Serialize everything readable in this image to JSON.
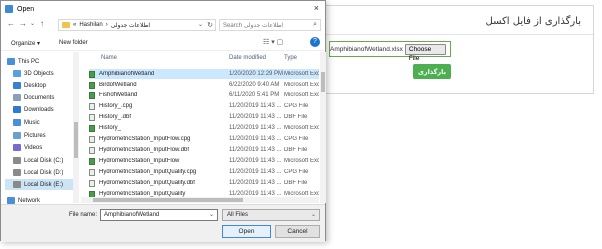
{
  "web": {
    "title": "بارگذاری از فایل اکسل",
    "file_name": "AmphibianofWetland.xlsx",
    "choose_label": "Choose File",
    "upload_label": "بارگذاری",
    "colors": {
      "upload": "#4cb050",
      "border": "#6aa84f"
    }
  },
  "dialog": {
    "title": "Open",
    "close_glyph": "×",
    "nav": {
      "back": "←",
      "forward": "→",
      "up": "↑",
      "recent": "⌄"
    },
    "address": {
      "prefix": "«",
      "part1": "Hashilan",
      "sep": "›",
      "part2": "اطلاعات جدولی",
      "dropdown": "⌄",
      "refresh": "↻"
    },
    "search": {
      "placeholder": "Search اطلاعات جدولی",
      "icon": "⌕"
    },
    "toolbar": {
      "organize": "Organize ▾",
      "new_folder": "New folder",
      "view": "☷ ▾ ▢",
      "help": "?"
    },
    "sidebar": [
      {
        "label": "This PC",
        "icon": "computer-icon",
        "color": "#4a90d9"
      },
      {
        "label": "3D Objects",
        "icon": "cube-icon",
        "color": "#5aa0e0"
      },
      {
        "label": "Desktop",
        "icon": "desktop-icon",
        "color": "#3b7fd0"
      },
      {
        "label": "Documents",
        "icon": "documents-icon",
        "color": "#8aa0b8"
      },
      {
        "label": "Downloads",
        "icon": "download-icon",
        "color": "#2f7ad0"
      },
      {
        "label": "Music",
        "icon": "music-icon",
        "color": "#4a90d9"
      },
      {
        "label": "Pictures",
        "icon": "pictures-icon",
        "color": "#6aa0d0"
      },
      {
        "label": "Videos",
        "icon": "videos-icon",
        "color": "#7a6ad0"
      },
      {
        "label": "Local Disk (C:)",
        "icon": "disk-icon",
        "color": "#8a8a8a"
      },
      {
        "label": "Local Disk (D:)",
        "icon": "disk-icon",
        "color": "#8a8a8a"
      },
      {
        "label": "Local Disk (E:)",
        "icon": "disk-icon",
        "color": "#8a8a8a"
      },
      {
        "label": "Network",
        "icon": "network-icon",
        "color": "#4a90d9"
      }
    ],
    "columns": {
      "name": "Name",
      "date": "Date modified",
      "type": "Type"
    },
    "files": [
      {
        "name": "AmphibianofWetland",
        "date": "1/20/2020 12:29 PM",
        "type": "Microsoft Excel",
        "icon": "excel-icon",
        "selected": true
      },
      {
        "name": "BirdofWetland",
        "date": "6/22/2020 9:40 AM",
        "type": "Microsoft Excel",
        "icon": "excel-icon"
      },
      {
        "name": "FishofWetland",
        "date": "6/11/2020 5:41 PM",
        "type": "Microsoft Excel",
        "icon": "excel-icon"
      },
      {
        "name": "History_.cpg",
        "date": "11/20/2019 11:43 ...",
        "type": "CPG File",
        "icon": "file-icon"
      },
      {
        "name": "History_.dbf",
        "date": "11/20/2019 11:43 ...",
        "type": "DBF File",
        "icon": "file-icon"
      },
      {
        "name": "History_",
        "date": "11/20/2019 11:43 ...",
        "type": "Microsoft Excel",
        "icon": "excel-icon"
      },
      {
        "name": "HydrometricStation_InputFlow.cpg",
        "date": "11/20/2019 11:43 ...",
        "type": "CPG File",
        "icon": "file-icon"
      },
      {
        "name": "HydrometricStation_InputFlow.dbf",
        "date": "11/20/2019 11:43 ...",
        "type": "DBF File",
        "icon": "file-icon"
      },
      {
        "name": "HydrometricStation_InputFlow",
        "date": "11/20/2019 11:43 ...",
        "type": "Microsoft Excel",
        "icon": "excel-icon"
      },
      {
        "name": "HydrometricStation_InputQuality.cpg",
        "date": "11/20/2019 11:43 ...",
        "type": "CPG File",
        "icon": "file-icon"
      },
      {
        "name": "HydrometricStation_InputQuality.dbf",
        "date": "11/20/2019 11:43 ...",
        "type": "DBF File",
        "icon": "file-icon"
      },
      {
        "name": "HydrometricStation_InputQuality",
        "date": "11/20/2019 11:43 ...",
        "type": "Microsoft Excel",
        "icon": "excel-icon"
      }
    ],
    "footer": {
      "file_name_label": "File name:",
      "file_name_value": "AmphibianofWetland",
      "dropdown": "⌄",
      "filter": "All Files",
      "open": "Open",
      "cancel": "Cancel"
    }
  }
}
